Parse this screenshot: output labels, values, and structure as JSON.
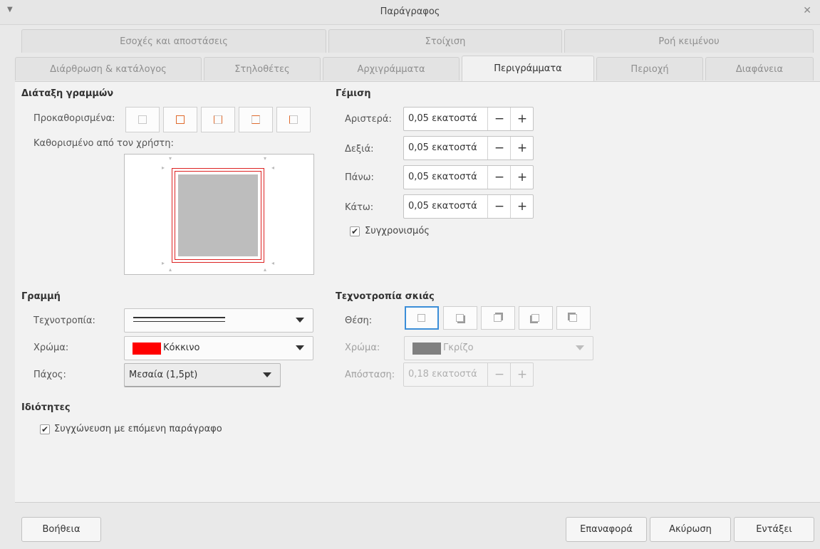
{
  "window": {
    "title": "Παράγραφος"
  },
  "tabs_row1": [
    "Εσοχές και αποστάσεις",
    "Στοίχιση",
    "Ροή κειμένου"
  ],
  "tabs_row2": [
    "Διάρθρωση & κατάλογος",
    "Στηλοθέτες",
    "Αρχιγράμματα",
    "Περιγράμματα",
    "Περιοχή",
    "Διαφάνεια"
  ],
  "active_tab": "Περιγράμματα",
  "line_arrangement": {
    "heading": "Διάταξη γραμμών",
    "presets_label": "Προκαθορισμένα:",
    "user_defined_label": "Καθορισμένο από τον χρήστη:"
  },
  "padding": {
    "heading": "Γέμιση",
    "left_label": "Αριστερά:",
    "left_value": "0,05 εκατοστά",
    "right_label": "Δεξιά:",
    "right_value": "0,05 εκατοστά",
    "top_label": "Πάνω:",
    "top_value": "0,05 εκατοστά",
    "bottom_label": "Κάτω:",
    "bottom_value": "0,05 εκατοστά",
    "sync_label": "Συγχρονισμός",
    "sync_checked": true,
    "minus": "−",
    "plus": "+"
  },
  "line": {
    "heading": "Γραμμή",
    "style_label": "Τεχνοτροπία:",
    "color_label": "Χρώμα:",
    "color_value": "Κόκκινο",
    "color_hex": "#ff0000",
    "width_label": "Πάχος:",
    "width_value": "Μεσαία (1,5pt)"
  },
  "shadow": {
    "heading": "Τεχνοτροπία σκιάς",
    "position_label": "Θέση:",
    "color_label": "Χρώμα:",
    "color_value": "Γκρίζο",
    "color_hex": "#808080",
    "distance_label": "Απόσταση:",
    "distance_value": "0,18 εκατοστά"
  },
  "properties": {
    "heading": "Ιδιότητες",
    "merge_label": "Συγχώνευση με επόμενη παράγραφο",
    "merge_checked": true
  },
  "buttons": {
    "help": "Βοήθεια",
    "reset": "Επαναφορά",
    "cancel": "Ακύρωση",
    "ok": "Εντάξει"
  },
  "icons": {
    "window_menu": "chevron-down-icon",
    "close": "close-icon",
    "check": "✔"
  }
}
